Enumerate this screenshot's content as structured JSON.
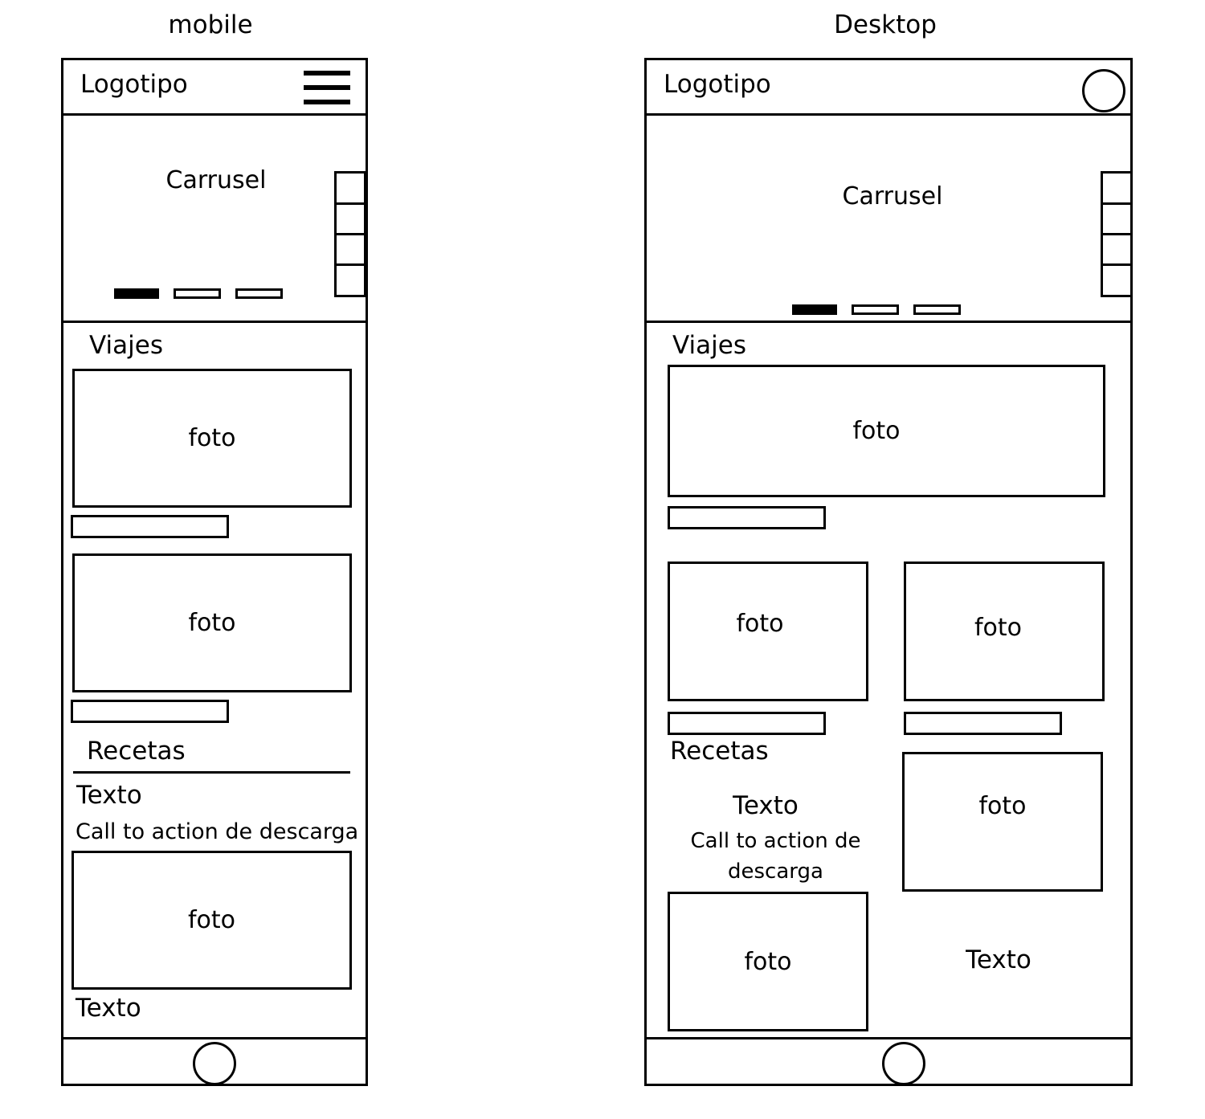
{
  "mobile": {
    "heading": "mobile",
    "logo": "Logotipo",
    "menu_icon": "hamburger-icon",
    "carousel_label": "Carrusel",
    "section_travel": "Viajes",
    "photo_label": "foto",
    "section_recipes": "Recetas",
    "text_label": "Texto",
    "cta": "Call to action de descarga",
    "home_button_icon": "circle-icon"
  },
  "desktop": {
    "heading": "Desktop",
    "logo": "Logotipo",
    "account_icon": "circle-icon",
    "carousel_label": "Carrusel",
    "section_travel": "Viajes",
    "photo_label": "foto",
    "section_recipes": "Recetas",
    "text_label": "Texto",
    "cta_line1": "Call to action de",
    "cta_line2": "descarga",
    "home_button_icon": "circle-icon"
  }
}
